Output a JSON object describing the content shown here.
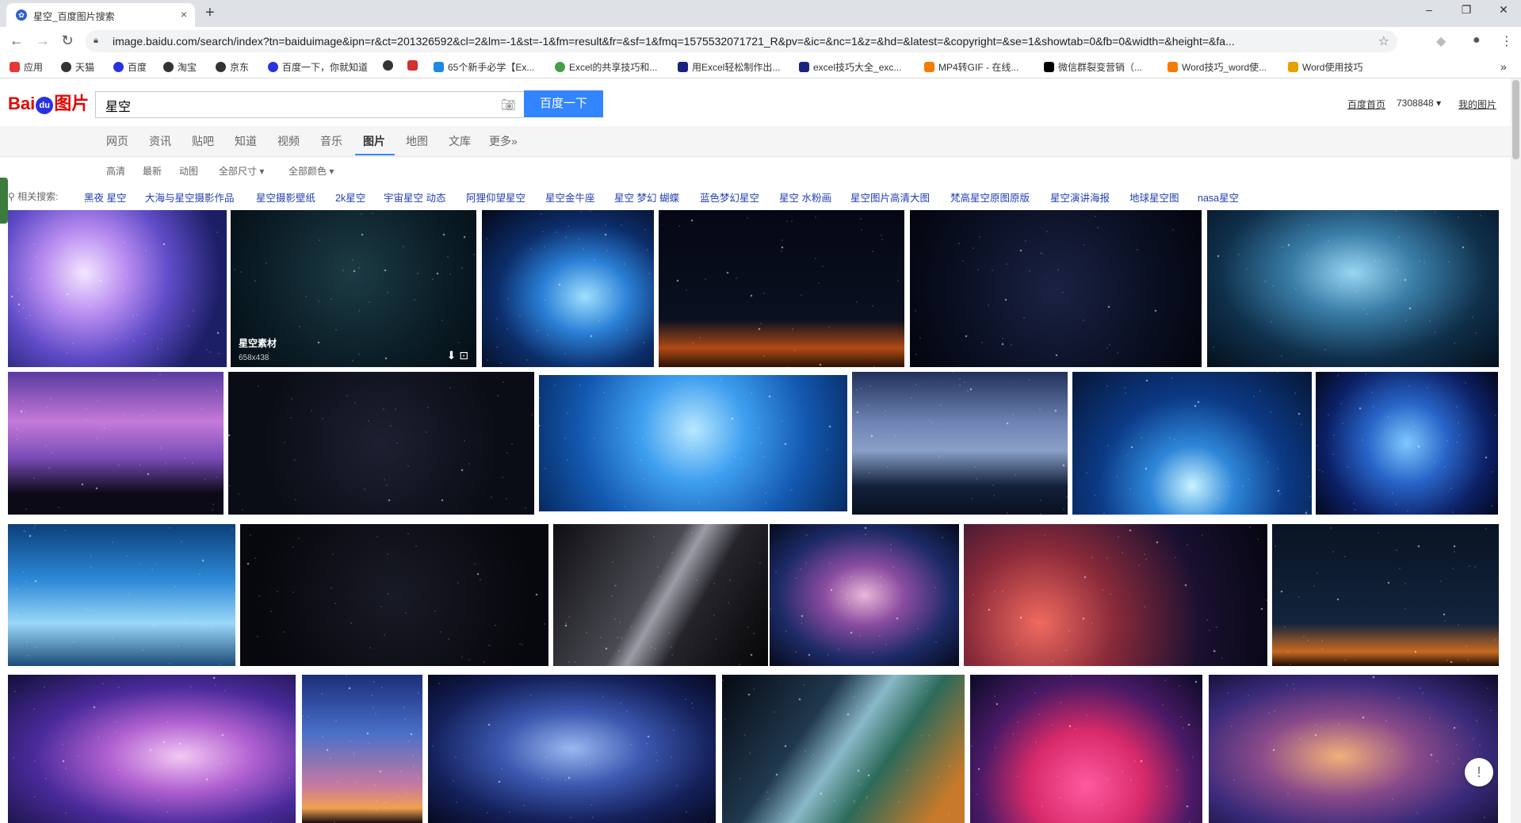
{
  "browser": {
    "tab_title": "星空_百度图片搜索",
    "tab_close": "×",
    "new_tab": "+",
    "url": "image.baidu.com/search/index?tn=baiduimage&ipn=r&ct=201326592&cl=2&lm=-1&st=-1&fm=result&fr=&sf=1&fmq=1575532071721_R&pv=&ic=&nc=1&z=&hd=&latest=&copyright=&se=1&showtab=0&fb=0&width=&height=&fa...",
    "bookmarks": [
      {
        "label": "应用",
        "color": "#e53935"
      },
      {
        "label": "天猫",
        "color": "#333333"
      },
      {
        "label": "百度",
        "color": "#2932e1"
      },
      {
        "label": "淘宝",
        "color": "#333333"
      },
      {
        "label": "京东",
        "color": "#333333"
      },
      {
        "label": "百度一下，你就知道",
        "color": "#2932e1"
      },
      {
        "label": "",
        "color": "#333333"
      },
      {
        "label": "",
        "color": "#d32f2f"
      },
      {
        "label": "65个新手必学【Ex...",
        "color": "#1e88e5"
      },
      {
        "label": "Excel的共享技巧和...",
        "color": "#43a047"
      },
      {
        "label": "用Excel轻松制作出...",
        "color": "#1a237e"
      },
      {
        "label": "excel技巧大全_exc...",
        "color": "#1a237e"
      },
      {
        "label": "MP4转GIF - 在线...",
        "color": "#f57c00"
      },
      {
        "label": "微信群裂变营销（...",
        "color": "#000000"
      },
      {
        "label": "Word技巧_word使...",
        "color": "#f57c00"
      },
      {
        "label": "Word使用技巧",
        "color": "#e6a100"
      }
    ]
  },
  "header": {
    "logo_pre": "Bai",
    "logo_paw": "du",
    "logo_post": "图片",
    "query": "星空",
    "search_button": "百度一下",
    "links": [
      "百度首页",
      "7308848",
      "我的图片"
    ]
  },
  "nav": {
    "items": [
      "网页",
      "资讯",
      "贴吧",
      "知道",
      "视频",
      "音乐",
      "图片",
      "地图",
      "文库",
      "更多»"
    ],
    "active": "图片"
  },
  "filters": [
    "高清",
    "最新",
    "动图",
    "全部尺寸",
    "全部颜色"
  ],
  "related": {
    "label": "相关搜索:",
    "items": [
      "黑夜 星空",
      "大海与星空摄影作品",
      "星空摄影壁纸",
      "2k星空",
      "宇宙星空 动态",
      "阿狸仰望星空",
      "星空金牛座",
      "星空 梦幻 蝴蝶",
      "蓝色梦幻星空",
      "星空 水粉画",
      "星空图片高清大图",
      "梵高星空原图原版",
      "星空演讲海报",
      "地球星空图",
      "nasa星空"
    ]
  },
  "hover_card": {
    "caption": "星空素材",
    "dims": "658x438"
  },
  "feedback": "!",
  "images": [
    {
      "id": "r1c1",
      "style": "radial-gradient(circle at 35% 40%,#f4e6ff 0%,#b88cf0 25%,#5f4bc7 50%,#1c1f66 80%)"
    },
    {
      "id": "r1c2",
      "style": "radial-gradient(circle at 50% 40%,#1c3b44 0%,#0b1d26 60%,#050d14 100%)"
    },
    {
      "id": "r1c3",
      "style": "radial-gradient(ellipse at 60% 55%,#9fe0ff 0%,#2a7fd6 30%,#0c2d6a 60%,#040818 100%)"
    },
    {
      "id": "r1c4",
      "style": "linear-gradient(#050814 0%,#0a1020 70%,#b04a15 88%,#2a1205 100%)"
    },
    {
      "id": "r1c5",
      "style": "radial-gradient(circle at 50% 50%,#1a2244 0%,#0a0f22 60%,#03050d 100%)"
    },
    {
      "id": "r1c6",
      "style": "radial-gradient(ellipse at 50% 40%,#9ad6f2 0%,#3a7ea8 30%,#0f2f4a 65%,#05101c 100%)"
    },
    {
      "id": "r2c1",
      "style": "linear-gradient(#5a3aa0 0%,#c47ad8 35%,#7a4cb8 60%,#0d0a18 85%)"
    },
    {
      "id": "r2c2",
      "style": "radial-gradient(circle at 50% 50%,#1c2030 0%,#0b0d16 70%)"
    },
    {
      "id": "r2c3",
      "style": "radial-gradient(circle at 50% 40%,#b8e8ff 0%,#3f9ff0 30%,#1358b0 65%,#072a60 100%)"
    },
    {
      "id": "r2c4",
      "style": "linear-gradient(#20325a 0%,#6e82b4 35%,#8aa0c8 55%,#12203a 80%,#0a1020 100%)"
    },
    {
      "id": "r2c5",
      "style": "radial-gradient(ellipse at 50% 80%,#c8f4ff 0%,#2e86d8 25%,#0c3a86 55%,#061636 100%)"
    },
    {
      "id": "r2c6",
      "style": "radial-gradient(circle at 50% 50%,#7ec8ff 0%,#2864c8 35%,#0c2066 70%,#04081c 100%)"
    },
    {
      "id": "r3c1",
      "style": "linear-gradient(#0c3f7a 0%,#2e8ad8 40%,#9ad8f8 70%,#1c4c7a 100%)"
    },
    {
      "id": "r3c2",
      "style": "radial-gradient(circle at 50% 50%,#181a26 0%,#07080d 80%)"
    },
    {
      "id": "r3c3",
      "style": "linear-gradient(120deg,#0d0d12 0%,#4a4a52 45%,#9c9ca6 52%,#24242a 65%,#050507 100%)"
    },
    {
      "id": "r3c4",
      "style": "radial-gradient(ellipse at 50% 50%,#e8b8d8 0%,#8a4ca0 30%,#1c2a66 65%,#060a1c 100%)"
    },
    {
      "id": "r3c5",
      "style": "radial-gradient(circle at 25% 70%,#f06a60 0%,#8a2a3a 30%,#1a1030 65%,#050610 100%)"
    },
    {
      "id": "r3c6",
      "style": "linear-gradient(#0a1424 0%,#12243c 70%,#c86a22 90%,#1a0a04 100%)"
    },
    {
      "id": "r4c1",
      "style": "radial-gradient(ellipse at 60% 55%,#f4c8f4 0%,#b060d0 30%,#4a2a9a 60%,#12103a 100%)"
    },
    {
      "id": "r4c2",
      "style": "linear-gradient(#1c2e7a 0%,#4a70c8 40%,#c87aa0 75%,#f0a050 90%,#1a0c10 100%)"
    },
    {
      "id": "r4c3",
      "style": "radial-gradient(ellipse at 50% 50%,#9ab8f0 0%,#3c58b0 35%,#14205a 70%,#060a20 100%)"
    },
    {
      "id": "r4c4",
      "style": "linear-gradient(125deg,#060a12 0%,#20384e 35%,#8ab8c8 50%,#2c6a5a 65%,#c87a2a 90%)"
    },
    {
      "id": "r4c5",
      "style": "radial-gradient(ellipse at 50% 75%,#ff5aa0 0%,#d82a6a 35%,#4a1a66 65%,#0a0a26 100%)"
    },
    {
      "id": "r4c6",
      "style": "radial-gradient(ellipse at 45% 55%,#f2b07a 0%,#8a4a8a 35%,#3a2a7a 65%,#0e0a2a 100%)"
    }
  ]
}
